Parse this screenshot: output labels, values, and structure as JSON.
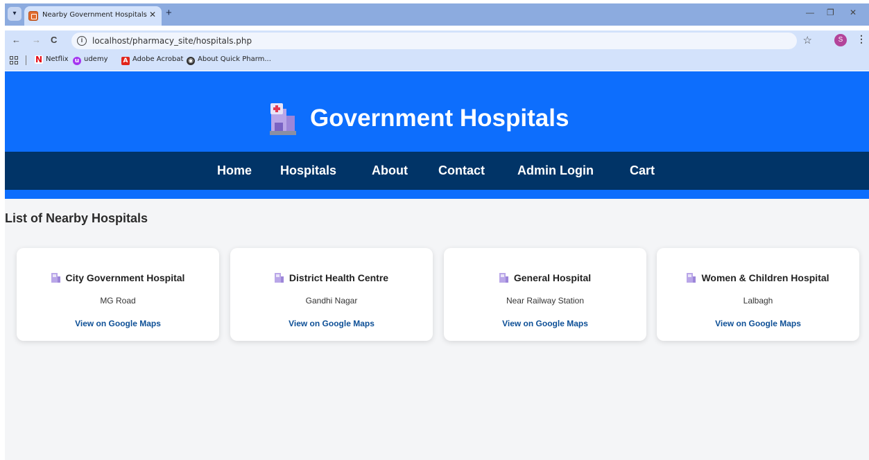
{
  "browser": {
    "tab_title": "Nearby Government Hospitals",
    "url": "localhost/pharmacy_site/hospitals.php",
    "profile_initial": "S",
    "bookmarks": [
      {
        "label": "Netflix",
        "icon": "netflix-icon",
        "color": "#e50914"
      },
      {
        "label": "udemy",
        "icon": "udemy-icon",
        "color": "#a435f0"
      },
      {
        "label": "Adobe Acrobat",
        "icon": "acrobat-icon",
        "color": "#e1261c"
      },
      {
        "label": "About Quick Pharm...",
        "icon": "globe-icon",
        "color": "#333333"
      }
    ]
  },
  "header": {
    "title": "Government Hospitals",
    "logo_icon": "hospital-icon",
    "bg_color": "#0d6efd"
  },
  "nav": {
    "bg_color": "#013467",
    "items": [
      "Home",
      "Hospitals",
      "About",
      "Contact",
      "Admin Login",
      "Cart"
    ]
  },
  "section_title": "List of Nearby Hospitals",
  "hospitals": [
    {
      "name": "City Government Hospital",
      "address": "MG Road",
      "link": "View on Google Maps"
    },
    {
      "name": "District Health Centre",
      "address": "Gandhi Nagar",
      "link": "View on Google Maps"
    },
    {
      "name": "General Hospital",
      "address": "Near Railway Station",
      "link": "View on Google Maps"
    },
    {
      "name": "Women & Children Hospital",
      "address": "Lalbagh",
      "link": "View on Google Maps"
    }
  ]
}
